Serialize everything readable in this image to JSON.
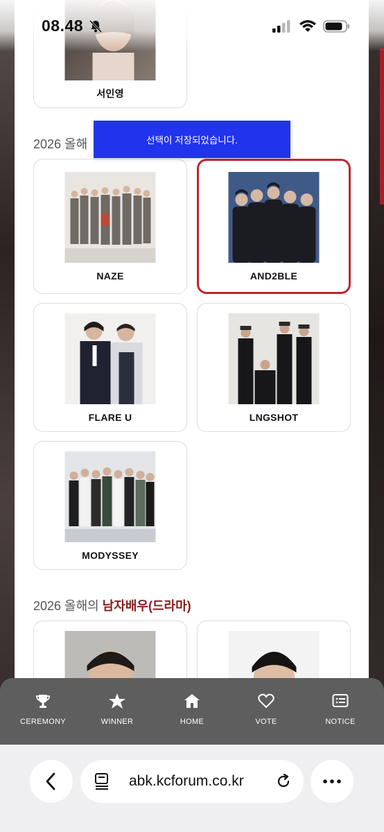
{
  "status_bar": {
    "time": "08.48"
  },
  "toast": {
    "message": "선택이 저장되었습니다."
  },
  "top_card": {
    "name": "서인영"
  },
  "sections": [
    {
      "prefix": "2026 올해",
      "accent": ""
    },
    {
      "prefix": "2026 올해의 ",
      "accent": "남자배우(드라마)"
    }
  ],
  "nominees": [
    {
      "name": "NAZE",
      "selected": false
    },
    {
      "name": "AND2BLE",
      "selected": true
    },
    {
      "name": "FLARE U",
      "selected": false
    },
    {
      "name": "LNGSHOT",
      "selected": false
    },
    {
      "name": "MODYSSEY",
      "selected": false
    }
  ],
  "tabbar": {
    "items": [
      {
        "label": "CEREMONY",
        "icon": "trophy-icon"
      },
      {
        "label": "WINNER",
        "icon": "star-icon"
      },
      {
        "label": "HOME",
        "icon": "home-icon"
      },
      {
        "label": "VOTE",
        "icon": "heart-icon"
      },
      {
        "label": "NOTICE",
        "icon": "notice-icon"
      }
    ]
  },
  "browser": {
    "url": "abk.kcforum.co.kr"
  },
  "colors": {
    "accent": "#8b1a1a",
    "selected_border": "#c0272d",
    "toast_bg": "#2233ee",
    "tabbar_bg": "#5e5e5e"
  }
}
